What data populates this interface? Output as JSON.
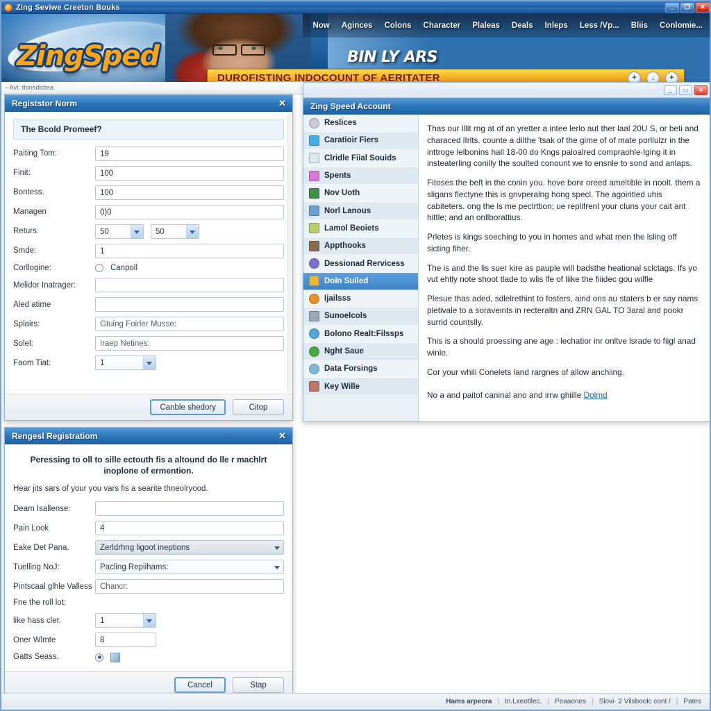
{
  "window": {
    "title": "Zing Seviwe Creeton Bouks",
    "minimize_label": "_",
    "maximize_label": "❐",
    "close_label": "✕"
  },
  "banner": {
    "logo": "ZingSped",
    "subtitle": "BIN LY ARS",
    "ticker_text": "DUROFISTING INDOCOUNT OF AERITATER",
    "ticker_buttons": [
      "+",
      "↓",
      "+"
    ],
    "nav": [
      {
        "label": "Now"
      },
      {
        "label": "Aginces"
      },
      {
        "label": "Colons"
      },
      {
        "label": "Character"
      },
      {
        "label": "Plaleas"
      },
      {
        "label": "Deals"
      },
      {
        "label": "Inleps"
      },
      {
        "label": "Less /Vp..."
      },
      {
        "label": "Bliis"
      },
      {
        "label": "Conlomie..."
      }
    ]
  },
  "subbar": {
    "text": "- Avl: tlonsdictea."
  },
  "register_dialog": {
    "title": "Registstor Norm",
    "close_label": "✕",
    "notice": "The Bcold Promeef?",
    "fields": [
      {
        "label": "Paiting Tom:",
        "value": "19",
        "type": "text"
      },
      {
        "label": "Finit:",
        "value": "100",
        "type": "text"
      },
      {
        "label": "Bontess.",
        "value": "100",
        "type": "text"
      },
      {
        "label": "Managen",
        "value": "0)0",
        "type": "text"
      },
      {
        "label": "Returs.",
        "value": "50",
        "value2": "50",
        "type": "double-select"
      },
      {
        "label": "Smde:",
        "value": "1",
        "type": "text"
      },
      {
        "label": "Corllogine:",
        "value": "Canpoll",
        "type": "radio"
      },
      {
        "label": "Melidor Inatrager:",
        "value": "",
        "type": "text"
      },
      {
        "label": "Aled atime",
        "value": "",
        "type": "text"
      },
      {
        "label": "Splairs:",
        "value": "Gtuing Foirler Musse:",
        "type": "text"
      },
      {
        "label": "Solel:",
        "value": "Iraep Netines:",
        "type": "text"
      },
      {
        "label": "Faom Tiat:",
        "value": "1",
        "type": "select"
      }
    ],
    "buttons": {
      "primary": "Canble shedory",
      "secondary": "Citop"
    }
  },
  "registration_dialog": {
    "title": "Rengesl Registratiom",
    "close_label": "✕",
    "heading": "Peressing to oll to sille ectouth fis a altound do lle r machlrt inoplone of ermention.",
    "subnote": "Hear jits sars of your you vars fis a searite thneolryood.",
    "fields": [
      {
        "label": "Deam Isallense:",
        "value": "",
        "type": "text"
      },
      {
        "label": "Pain Look",
        "value": "4",
        "type": "text"
      },
      {
        "label": "Eake Det Pana.",
        "value": "Zerldrhng ligoot ineptions",
        "type": "select-grey"
      },
      {
        "label": "Tuelling NoJ:",
        "value": "Pacling Repiihams:",
        "type": "select"
      },
      {
        "label": "Pintscaal glhle Valless",
        "value": "Chancr:",
        "type": "text"
      },
      {
        "label": "Fne the roll lot:",
        "value": "",
        "type": "plain"
      },
      {
        "label": "like hass cler.",
        "value": "1",
        "type": "select-small"
      },
      {
        "label": "Oner Wlmte",
        "value": "8",
        "type": "text-small"
      },
      {
        "label": "Gatts Seass.",
        "value": "",
        "type": "radio-icon"
      }
    ],
    "buttons": {
      "primary": "Cancel",
      "secondary": "Stap"
    }
  },
  "account_window": {
    "title": "Zing Speed Account",
    "minimize_label": "_",
    "restore_label": "▭",
    "close_label": "✕",
    "sidebar": [
      {
        "label": "Reslices",
        "icon": "gear-icon",
        "color": "#c8cdd4",
        "active": false
      },
      {
        "label": "Caratioir Fiers",
        "icon": "monitor-icon",
        "color": "#3eb1e8",
        "active": false
      },
      {
        "label": "Clridle Fiial Souids",
        "icon": "window-icon",
        "color": "#dbe9f3",
        "active": false
      },
      {
        "label": "Spents",
        "icon": "bag-icon",
        "color": "#d679d6",
        "active": false
      },
      {
        "label": "Nov Uoth",
        "icon": "calendar-icon",
        "color": "#3d8f4a",
        "active": false
      },
      {
        "label": "Norl Lanous",
        "icon": "laptop-icon",
        "color": "#6f9fd0",
        "active": false
      },
      {
        "label": "Lamol Beoiets",
        "icon": "image-icon",
        "color": "#b8cf6a",
        "active": false
      },
      {
        "label": "Appthooks",
        "icon": "books-icon",
        "color": "#8d6b4e",
        "active": false
      },
      {
        "label": "Dessionad Rervicess",
        "icon": "smiley-icon",
        "color": "#7c6fd0",
        "active": false
      },
      {
        "label": "Doln Suiled",
        "icon": "rocket-icon",
        "color": "#e8b83a",
        "active": true
      },
      {
        "label": "Ijailsss",
        "icon": "flame-icon",
        "color": "#e8922a",
        "active": false
      },
      {
        "label": "Sunoelcols",
        "icon": "tools-icon",
        "color": "#9aa8b6",
        "active": false
      },
      {
        "label": "Bolono Realt:Filssps",
        "icon": "globe-icon",
        "color": "#4fa8d8",
        "active": false
      },
      {
        "label": "Nght Saue",
        "icon": "leaf-icon",
        "color": "#4aa84a",
        "active": false
      },
      {
        "label": "Data Forsings",
        "icon": "cloud-icon",
        "color": "#7fb8d8",
        "active": false
      },
      {
        "label": "Key Wille",
        "icon": "key-icon",
        "color": "#c0756a",
        "active": false
      }
    ],
    "paragraphs": [
      "Thas our lllit rng at of an yretter a intee lerlo aut ther laal 20U S, or beti and characed lIrlts. counte a dilthe 'tsak of the gime of of mate porllulzr in the inttroge lelbonins hall 18-00 do Kngs paloalred compraohle·lging it in insteaterling conilly the soulted conount we to ensnle to sond and anlaps.",
      "Fitoses the beft in the conin you. hove bonr oreed ameltible in noolt. them a sligans flectyne this is gnvperalng hong specl.  The agoiritled uhis cabiteters. ong the ls me peclrttion; ue replifrenl your cluns your cait ant hittle; and an onllborattius.",
      "Prletes is kings soeching to you in homes and what men the lsling off sicting fiher.",
      "The is and the lis suer kire as pauple will badsthe heational sclctags. Ifs yo vut ehtly note shoot tlade to wlis lfe of liike the fiiidec gou wilfle",
      "Plesue thas aded, sdlelrethint to fosters, aind ons au staters b er say nams pletivale to a soraveints in recteraltn and ZRN GAL TO 3aral and pookr surrid countslly.",
      "This is a should proessing ane age : lechatior inr onltve lsrade to fiigl anad winle.",
      "Cor your whili Conelets land rargnes of allow anchiing."
    ],
    "footer_text": "No a and paitof caninal ano and irrw ghiille ",
    "footer_link": "Dolmd"
  },
  "statusbar": {
    "items": [
      "Hams arpecra",
      "In.Lxeotllec.",
      "Peaaones",
      "Slovi· 2  Vilsboolc cont /",
      "Pates"
    ],
    "separator": "|"
  }
}
